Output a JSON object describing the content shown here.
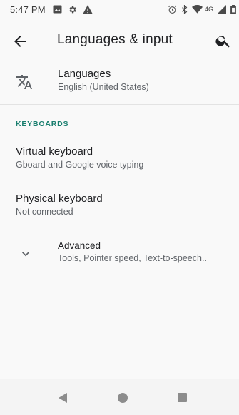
{
  "status_bar": {
    "time": "5:47 PM",
    "network": "4G",
    "left_icons": [
      "image-icon",
      "settings-icon",
      "warning-icon"
    ],
    "right_icons": [
      "alarm-icon",
      "bluetooth-icon",
      "wifi-icon",
      "signal-icon",
      "battery-icon"
    ]
  },
  "toolbar": {
    "title": "Languages & input",
    "back_icon": "arrow-back-icon",
    "search_icon": "search-icon"
  },
  "languages": {
    "title": "Languages",
    "subtitle": "English (United States)",
    "icon": "translate-icon"
  },
  "keyboards_section": {
    "header": "KEYBOARDS",
    "virtual": {
      "title": "Virtual keyboard",
      "subtitle": "Gboard and Google voice typing"
    },
    "physical": {
      "title": "Physical keyboard",
      "subtitle": "Not connected"
    }
  },
  "advanced": {
    "title": "Advanced",
    "subtitle": "Tools, Pointer speed, Text-to-speech..",
    "icon": "chevron-down-icon"
  },
  "nav_bar": {
    "icons": [
      "nav-back-icon",
      "nav-home-icon",
      "nav-recents-icon"
    ]
  },
  "colors": {
    "accent": "#1a7f6f",
    "primary_text": "#202124",
    "secondary_text": "#5f6368",
    "background": "#f9f9f9"
  }
}
